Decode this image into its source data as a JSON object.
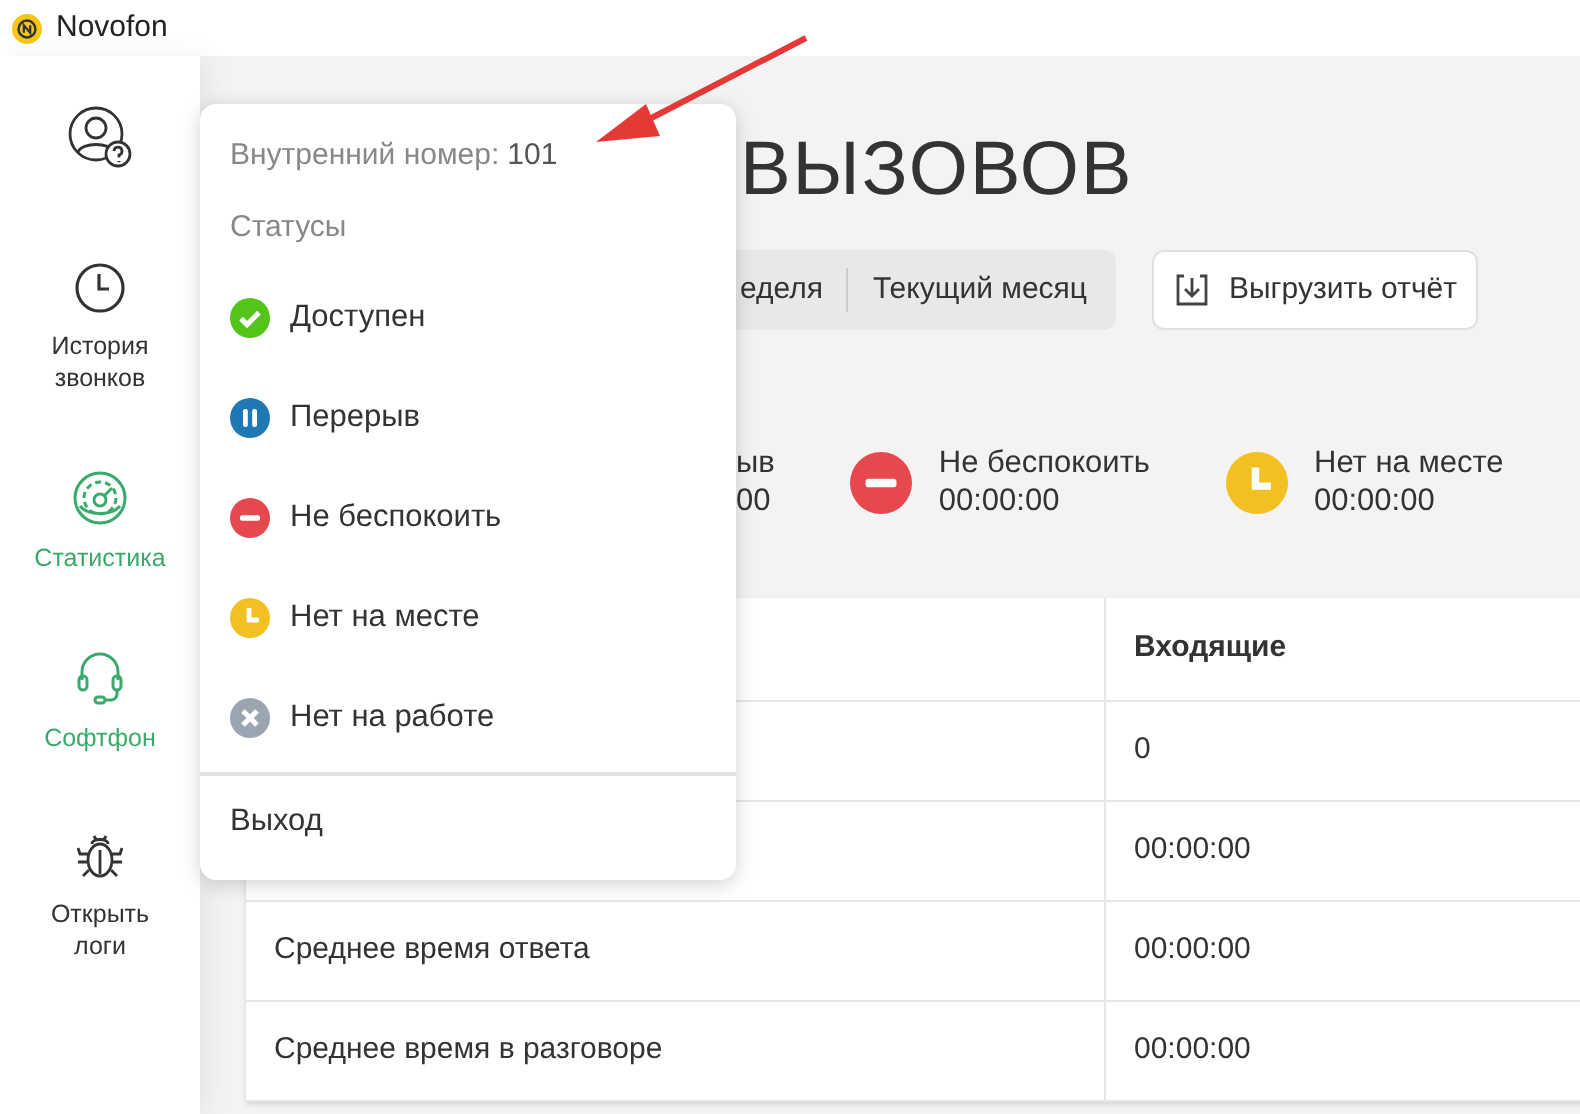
{
  "app": {
    "title": "Novofon"
  },
  "sidebar": {
    "items": [
      {
        "kind": "help",
        "active": false
      },
      {
        "kind": "history",
        "label": "История\nзвонков",
        "active": false
      },
      {
        "kind": "stats",
        "label": "Статистика",
        "active": true
      },
      {
        "kind": "softphone",
        "label": "Софтфон",
        "active": true
      },
      {
        "kind": "logs",
        "label": "Открыть\nлоги",
        "active": false
      }
    ]
  },
  "page": {
    "title": "ВЫЗОВОВ",
    "periods": [
      {
        "label": "еделя",
        "selected": false
      },
      {
        "label": "Текущий месяц",
        "selected": false
      }
    ],
    "export_button": "Выгрузить отчёт",
    "status_totals": [
      {
        "kind": "partial",
        "label": "ыв",
        "value": "00"
      },
      {
        "kind": "minus",
        "color": "#e5484d",
        "label": "Не беспокоить",
        "value": "00:00:00"
      },
      {
        "kind": "clock",
        "color": "#f2c021",
        "label": "Нет на месте",
        "value": "00:00:00"
      }
    ],
    "table": {
      "columns": [
        "",
        "Входящие"
      ],
      "rows": [
        [
          "",
          "0"
        ],
        [
          "",
          "00:00:00"
        ],
        [
          "Среднее время ответа",
          "00:00:00"
        ],
        [
          "Среднее время в разговоре",
          "00:00:00"
        ]
      ]
    }
  },
  "menu": {
    "extension_label": "Внутренний номер:",
    "extension": "101",
    "statuses_heading": "Статусы",
    "statuses": [
      {
        "kind": "check",
        "color": "#52c41a",
        "label": "Доступен"
      },
      {
        "kind": "pause",
        "color": "#1f77b4",
        "label": "Перерыв"
      },
      {
        "kind": "minus",
        "color": "#e5484d",
        "label": "Не беспокоить"
      },
      {
        "kind": "clock",
        "color": "#f2c021",
        "label": "Нет на месте"
      },
      {
        "kind": "cross",
        "color": "#9aa5b1",
        "label": "Нет на работе"
      }
    ],
    "logout": "Выход"
  }
}
